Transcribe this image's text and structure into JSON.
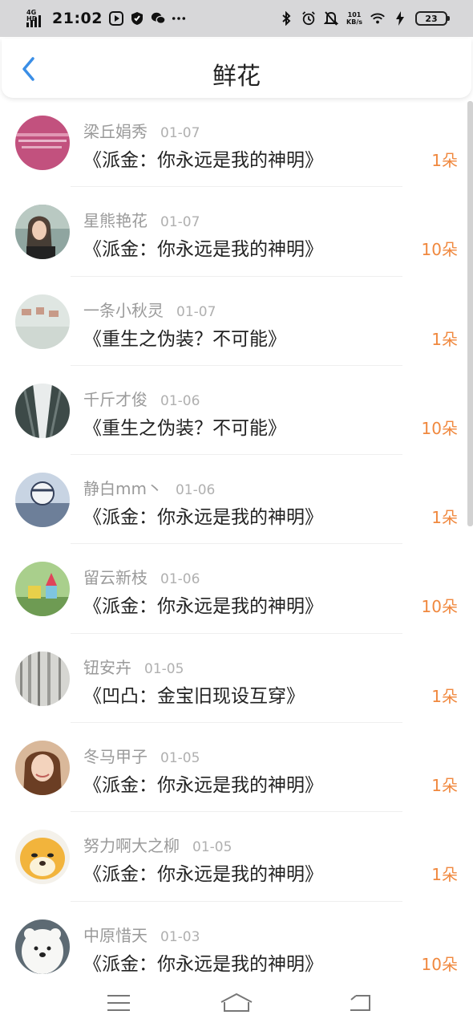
{
  "status_bar": {
    "network": "4G HD",
    "time": "21:02",
    "speed_value": "101",
    "speed_unit": "KB/s",
    "battery": "23",
    "icons": [
      "signal-icon",
      "play-icon",
      "shield-icon",
      "wechat-icon",
      "more-icon",
      "bluetooth-icon",
      "alarm-icon",
      "mute-icon",
      "wifi-icon",
      "charging-icon",
      "battery-icon"
    ]
  },
  "header": {
    "title": "鲜花",
    "back_icon": "back-chevron-icon"
  },
  "accent_color": "#f0883e",
  "back_color": "#3a8ee6",
  "flowers": [
    {
      "user": "梁丘娟秀",
      "date": "01-07",
      "book": "《派金：你永远是我的神明》",
      "count": "1朵"
    },
    {
      "user": "星熊艳花",
      "date": "01-07",
      "book": "《派金：你永远是我的神明》",
      "count": "10朵"
    },
    {
      "user": "一条小秋灵",
      "date": "01-07",
      "book": "《重生之伪装？不可能》",
      "count": "1朵"
    },
    {
      "user": "千斤才俊",
      "date": "01-06",
      "book": "《重生之伪装？不可能》",
      "count": "10朵"
    },
    {
      "user": "静白mm丶",
      "date": "01-06",
      "book": "《派金：你永远是我的神明》",
      "count": "1朵"
    },
    {
      "user": "留云新枝",
      "date": "01-06",
      "book": "《派金：你永远是我的神明》",
      "count": "10朵"
    },
    {
      "user": "钮安卉",
      "date": "01-05",
      "book": "《凹凸：金宝旧现设互穿》",
      "count": "1朵"
    },
    {
      "user": "冬马甲子",
      "date": "01-05",
      "book": "《派金：你永远是我的神明》",
      "count": "1朵"
    },
    {
      "user": "努力啊大之柳",
      "date": "01-05",
      "book": "《派金：你永远是我的神明》",
      "count": "1朵"
    },
    {
      "user": "中原惜天",
      "date": "01-03",
      "book": "《派金：你永远是我的神明》",
      "count": "10朵"
    }
  ],
  "nav": {
    "menu_icon": "menu-icon",
    "home_icon": "home-icon",
    "back_icon": "return-icon"
  }
}
